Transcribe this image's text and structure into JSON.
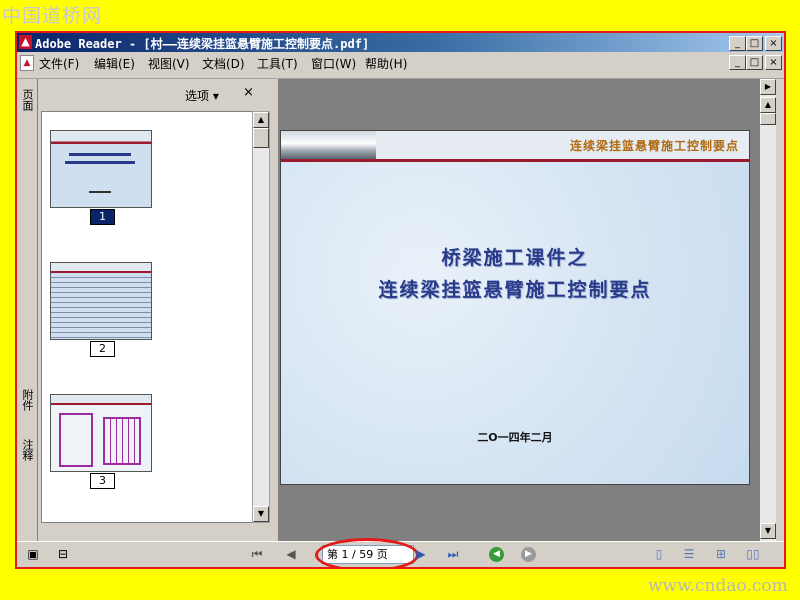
{
  "watermark": {
    "top": "中国道桥网",
    "bottom": "www.cndao.com"
  },
  "window": {
    "app_name": "Adobe Reader",
    "title": "Adobe Reader - [村——连续梁挂篮悬臂施工控制要点.pdf]",
    "controls": {
      "minimize": "_",
      "maximize": "□",
      "close": "×"
    }
  },
  "menu": [
    {
      "label": "文件(F)"
    },
    {
      "label": "编辑(E)"
    },
    {
      "label": "视图(V)"
    },
    {
      "label": "文档(D)"
    },
    {
      "label": "工具(T)"
    },
    {
      "label": "窗口(W)"
    },
    {
      "label": "帮助(H)"
    }
  ],
  "side_tabs": {
    "pages": "页面",
    "attachments": "附件",
    "comments": "注释"
  },
  "panel": {
    "options_label": "选项 ▾",
    "close": "×"
  },
  "thumbnails": [
    {
      "number": "1",
      "selected": true
    },
    {
      "number": "2",
      "selected": false
    },
    {
      "number": "3",
      "selected": false
    }
  ],
  "slide": {
    "header_title": "连续梁挂篮悬臂施工控制要点",
    "title_line1": "桥梁施工课件之",
    "title_line2": "连续梁挂篮悬臂施工控制要点",
    "date": "二O一四年二月"
  },
  "status": {
    "page_field": "第 1 / 59 页",
    "current_page": 1,
    "total_pages": 59
  },
  "colors": {
    "highlight": "#e21a1a",
    "accent_bar": "#9b1b2d",
    "title": "#2a3a8a"
  }
}
